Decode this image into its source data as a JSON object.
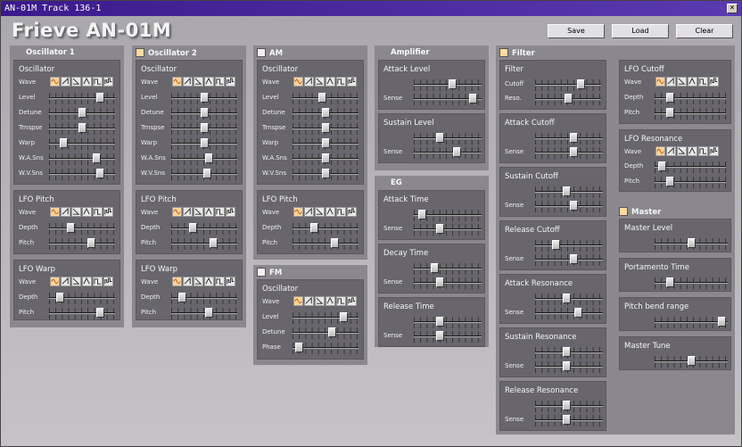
{
  "window": {
    "title": "AN-01M  Track 136-1",
    "close": "×"
  },
  "logo": "Frieve AN-01M",
  "buttons": {
    "save": "Save",
    "load": "Load",
    "clear": "Clear"
  },
  "lbl": {
    "wave": "Wave",
    "level": "Level",
    "detune": "Detune",
    "trnspse": "Trnspse",
    "warp": "Warp",
    "wasns": "W.A.Sns",
    "wvsns": "W.V.Sns",
    "depth": "Depth",
    "pitch": "Pitch",
    "phase": "Phase",
    "sense": "Sense",
    "cutoff": "Cutoff",
    "reso": "Reso."
  },
  "cols": {
    "osc1": "Oscillator 1",
    "osc2": "Oscillator 2",
    "am": "AM",
    "fm": "FM",
    "amp": "Amplifier",
    "eg": "EG",
    "filter": "Filter",
    "master": "Master"
  },
  "panels": {
    "oscillator": "Oscillator",
    "lfopitch": "LFO Pitch",
    "lfowarp": "LFO Warp",
    "attacklevel": "Attack Level",
    "sustainlevel": "Sustain Level",
    "attacktime": "Attack Time",
    "decaytime": "Decay Time",
    "releasetime": "Release Time",
    "filter": "Filter",
    "attackcutoff": "Attack Cutoff",
    "sustaincutoff": "Sustain Cutoff",
    "releasecutoff": "Release Cutoff",
    "attackres": "Attack Resonance",
    "sustainres": "Sustain Resonance",
    "releaseres": "Release Resonance",
    "lfocutoff": "LFO Cutoff",
    "lfores": "LFO Resonance",
    "masterlevel": "Master Level",
    "portamento": "Portamento Time",
    "pitchbend": "Pitch bend range",
    "mastertune": "Master Tune"
  },
  "wave_icons": [
    "sine-icon",
    "saw-up-icon",
    "saw-down-icon",
    "triangle-icon",
    "square-icon",
    "random-icon"
  ],
  "checks": {
    "osc1": null,
    "osc2": true,
    "am": false,
    "fm": false,
    "filter": true,
    "master": true
  },
  "colors": {
    "selected_wave": "#ffd49c",
    "panel": "#68666c",
    "column": "#8a888e"
  },
  "sliders": {
    "osc1": {
      "level": 0.82,
      "detune": 0.5,
      "trnspse": 0.5,
      "warp": 0.18,
      "wasns": 0.75,
      "wvsns": 0.82
    },
    "osc1lfop": {
      "depth": 0.3,
      "pitch": 0.66
    },
    "osc1lfow": {
      "depth": 0.12,
      "pitch": 0.82
    },
    "osc2": {
      "level": 0.5,
      "detune": 0.5,
      "trnspse": 0.5,
      "warp": 0.5,
      "wasns": 0.58,
      "wvsns": 0.55
    },
    "osc2lfop": {
      "depth": 0.3,
      "pitch": 0.66
    },
    "osc2lfow": {
      "depth": 0.12,
      "pitch": 0.58
    },
    "am": {
      "level": 0.45,
      "detune": 0.5,
      "trnspse": 0.5,
      "warp": 0.5,
      "wasns": 0.5,
      "wvsns": 0.5
    },
    "amlfop": {
      "depth": 0.3,
      "pitch": 0.66
    },
    "fm": {
      "level": 0.82,
      "detune": 0.62,
      "phase": 0.05
    },
    "ampattack": {
      "main": 0.58,
      "sense": 0.92
    },
    "ampsustain": {
      "main": 0.38,
      "sense": 0.65
    },
    "egattack": {
      "main": 0.08,
      "sense": 0.38
    },
    "egdecay": {
      "main": 0.28,
      "sense": 0.38
    },
    "egrelease": {
      "main": 0.38,
      "sense": 0.38
    },
    "filt": {
      "cutoff": 0.72,
      "reso": 0.5
    },
    "fattackc": {
      "main": 0.58,
      "sense": 0.58
    },
    "fsustainc": {
      "main": 0.46,
      "sense": 0.58
    },
    "freleasec": {
      "main": 0.28,
      "sense": 0.58
    },
    "fattackr": {
      "main": 0.46,
      "sense": 0.66
    },
    "fsustainr": {
      "main": 0.46,
      "sense": 0.46
    },
    "freleaser": {
      "main": 0.46,
      "sense": 0.46
    },
    "lfocut": {
      "depth": 0.18,
      "pitch": 0.18
    },
    "lfores": {
      "depth": 0.05,
      "pitch": 0.18
    },
    "mlevel": 0.5,
    "mporta": 0.18,
    "mpitchbend": 0.97,
    "mtune": 0.5
  }
}
